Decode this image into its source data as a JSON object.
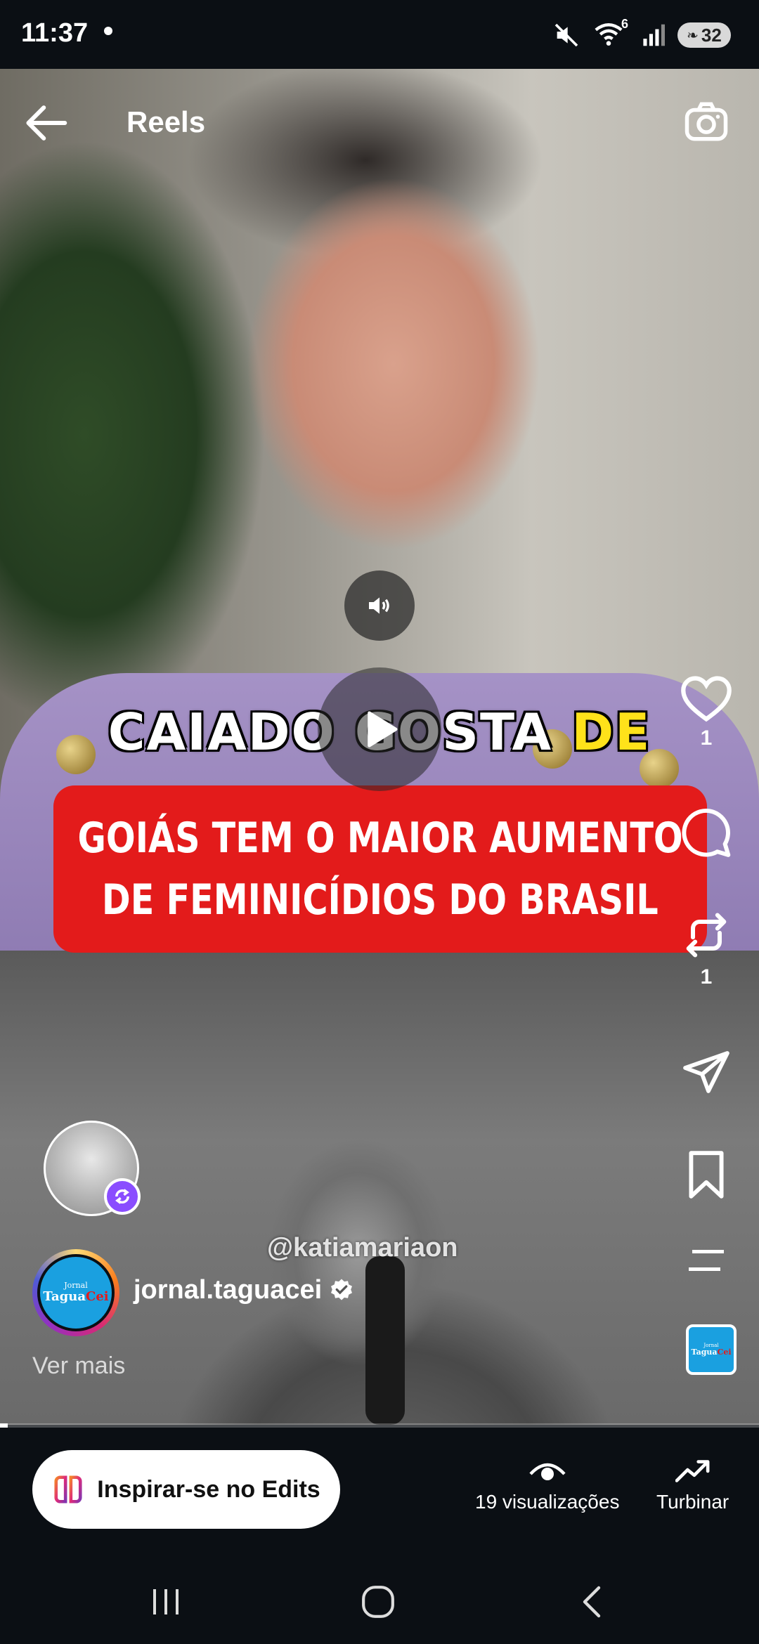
{
  "status_bar": {
    "time": "11:37",
    "wifi_badge": "6",
    "battery": "32"
  },
  "header": {
    "title": "Reels",
    "back_icon": "arrow-left-icon",
    "camera_icon": "camera-icon"
  },
  "video": {
    "caption_line1_white": "CAIADO GOSTA ",
    "caption_line1_yellow": "DE",
    "headline_line1": "GOIÁS TEM O MAIOR AUMENTO",
    "headline_line2": "DE FEMINICÍDIOS DO BRASIL",
    "watermark": "@katiamariaon",
    "progress": 0.01
  },
  "rail": {
    "likes": "1",
    "reposts": "1"
  },
  "author": {
    "name": "jornal.taguacei",
    "logo_small": "Jornal",
    "logo_part1": "Tagua",
    "logo_part2": "Cei",
    "see_more": "Ver mais"
  },
  "bottom": {
    "edits_label": "Inspirar-se no Edits",
    "views_label": "19 visualizações",
    "boost_label": "Turbinar"
  },
  "colors": {
    "accent_red": "#e31b1b",
    "caption_yellow": "#ffe21a",
    "repost_purple": "#8a4dff"
  }
}
